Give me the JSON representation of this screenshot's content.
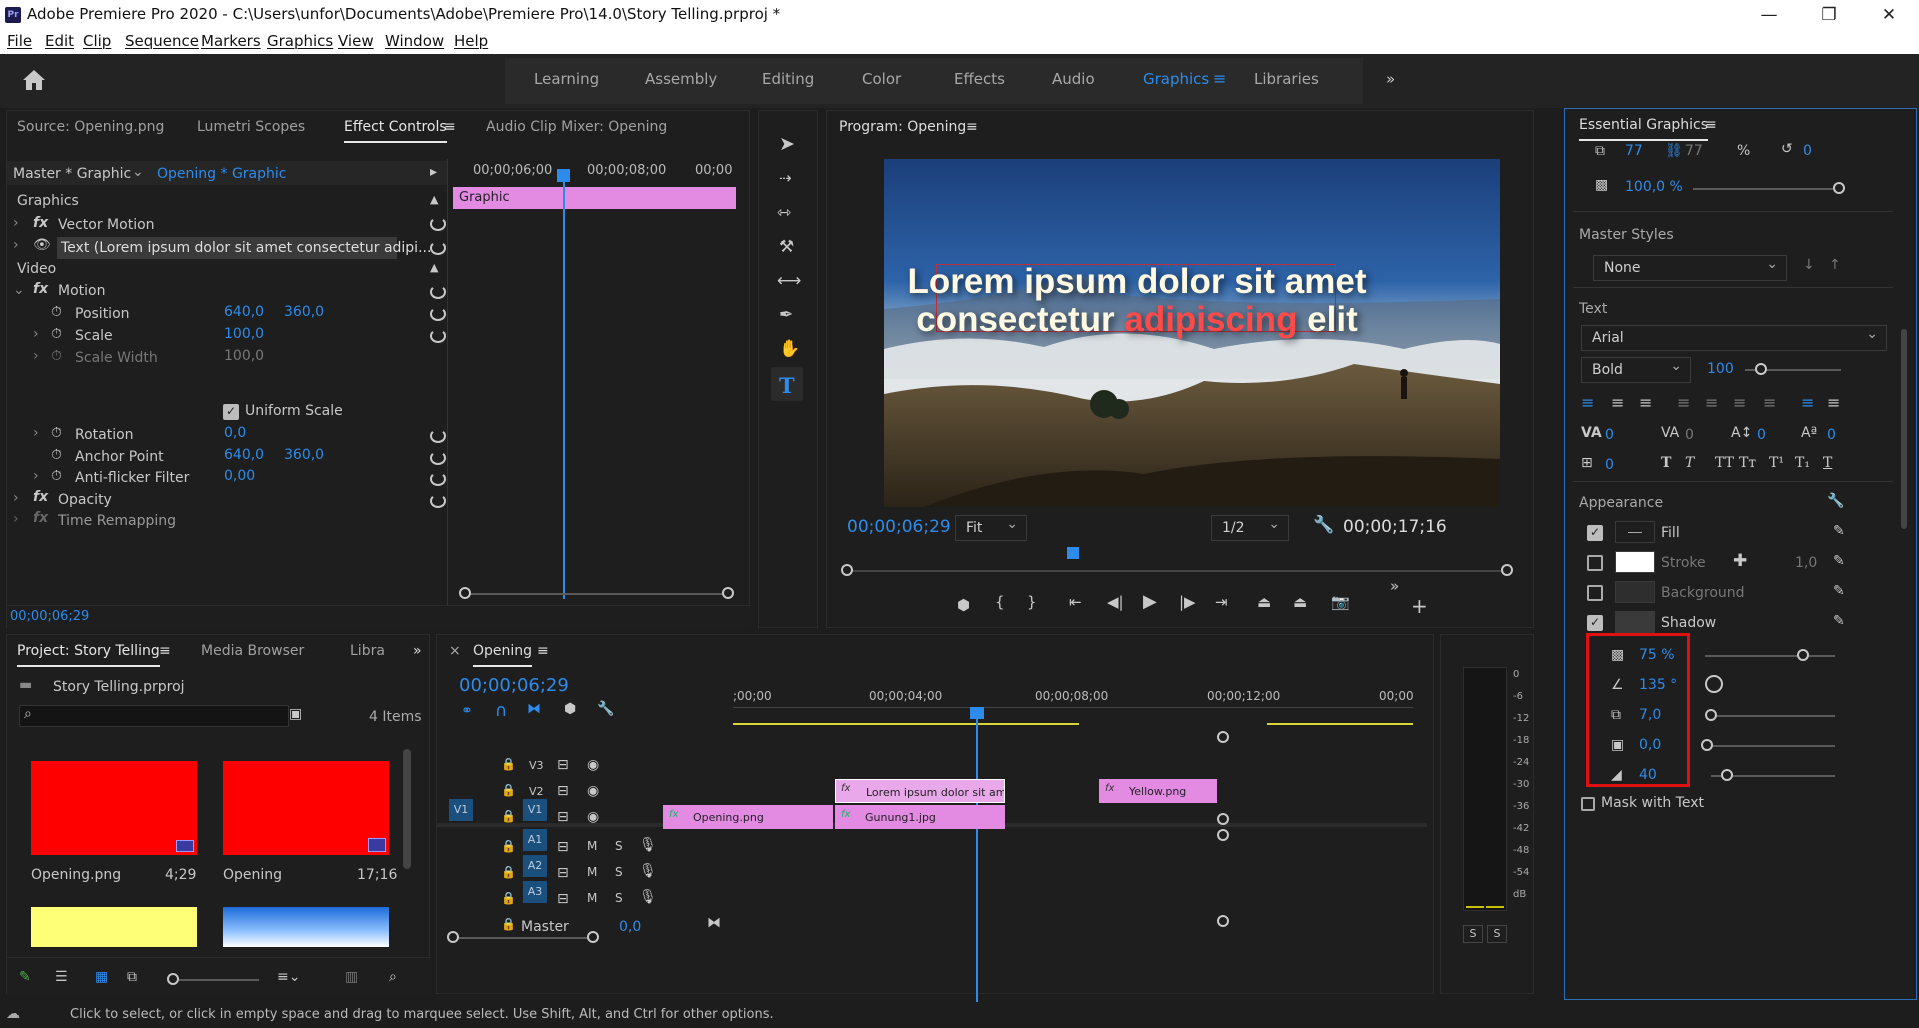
{
  "title_bar": {
    "app_title": "Adobe Premiere Pro 2020 - C:\\Users\\unfor\\Documents\\Adobe\\Premiere Pro\\14.0\\Story Telling.prproj *",
    "logo": "Pr"
  },
  "menu": [
    "File",
    "Edit",
    "Clip",
    "Sequence",
    "Markers",
    "Graphics",
    "View",
    "Window",
    "Help"
  ],
  "workspaces": [
    "Learning",
    "Assembly",
    "Editing",
    "Color",
    "Effects",
    "Audio",
    "Graphics",
    "Libraries"
  ],
  "active_workspace": "Graphics",
  "source_panel": {
    "tabs": [
      "Source: Opening.png",
      "Lumetri Scopes",
      "Effect Controls",
      "Audio Clip Mixer: Opening"
    ],
    "active": "Effect Controls"
  },
  "effect_controls": {
    "master": "Master * Graphic",
    "sequence_clip": "Opening * Graphic",
    "tc_start": "00;00;06;00",
    "tc_mid": "00;00;08;00",
    "tc_end": "00;00",
    "clip_label": "Graphic",
    "section_graphics": "Graphics",
    "vector_motion": "Vector Motion",
    "text_layer": "Text (Lorem ipsum dolor sit amet consectetur adipi...",
    "section_video": "Video",
    "motion": "Motion",
    "position_label": "Position",
    "position_x": "640,0",
    "position_y": "360,0",
    "scale_label": "Scale",
    "scale_value": "100,0",
    "scale_width_label": "Scale Width",
    "scale_width_value": "100,0",
    "uniform_scale": "Uniform Scale",
    "rotation_label": "Rotation",
    "rotation_value": "0,0",
    "anchor_label": "Anchor Point",
    "anchor_x": "640,0",
    "anchor_y": "360,0",
    "antiflicker_label": "Anti-flicker Filter",
    "antiflicker_value": "0,00",
    "opacity": "Opacity",
    "time_remap": "Time Remapping",
    "timecode": "00;00;06;29"
  },
  "program_monitor": {
    "title": "Program: Opening",
    "line1": "Lorem ipsum dolor sit amet",
    "line2_a": "consectetur ",
    "line2_b": "adipiscing",
    "line2_c": " elit",
    "timecode": "00;00;06;29",
    "fit": "Fit",
    "resolution": "1/2",
    "duration": "00;00;17;16"
  },
  "project": {
    "tabs": [
      "Project: Story Telling",
      "Media Browser",
      "Libra"
    ],
    "file": "Story Telling.prproj",
    "items_count": "4 Items",
    "items": [
      {
        "name": "Opening.png",
        "duration": "4;29",
        "color": "#ff0000"
      },
      {
        "name": "Opening",
        "duration": "17;16",
        "color": "#ff0000"
      }
    ]
  },
  "timeline": {
    "title": "Opening",
    "timecode": "00;00;06;29",
    "ruler": [
      ";00;00",
      "00;00;04;00",
      "00;00;08;00",
      "00;00;12;00",
      "00;00"
    ],
    "tracks_video": [
      "V3",
      "V2",
      "V1"
    ],
    "tracks_audio": [
      "A1",
      "A2",
      "A3"
    ],
    "source_patch": "V1",
    "master_label": "Master",
    "master_value": "0,0",
    "mute": "M",
    "solo": "S",
    "clips": {
      "v2_text": "Lorem ipsum dolor sit amet cons",
      "v2_yellow": "Yellow.png",
      "v1_opening": "Opening.png",
      "v1_gunung": "Gunung1.jpg"
    }
  },
  "audio_meter": {
    "scale": [
      "0",
      "-6",
      "-12",
      "-18",
      "-24",
      "-30",
      "-36",
      "-42",
      "-48",
      "-54",
      "dB"
    ],
    "solo_left": "S",
    "solo_right": "S"
  },
  "essential_graphics": {
    "title": "Essential Graphics",
    "w": "77",
    "h": "77",
    "pct": "%",
    "rot": "0",
    "opacity": "100,0 %",
    "master_styles_label": "Master Styles",
    "master_styles_value": "None",
    "text_label": "Text",
    "font": "Arial",
    "font_style": "Bold",
    "font_size": "100",
    "kerning": "0",
    "tracking": "0",
    "leading": "0",
    "baseline": "0",
    "tsume": "0",
    "appearance_label": "Appearance",
    "fill": "Fill",
    "stroke": "Stroke",
    "stroke_width": "1,0",
    "background": "Background",
    "shadow": "Shadow",
    "shadow_opacity": "75 %",
    "shadow_angle": "135 °",
    "shadow_distance": "7,0",
    "shadow_size": "0,0",
    "shadow_blur": "40",
    "mask_with_text": "Mask with Text"
  },
  "status_bar": {
    "text": "Click to select, or click in empty space and drag to marquee select. Use Shift, Alt, and Ctrl for other options."
  }
}
